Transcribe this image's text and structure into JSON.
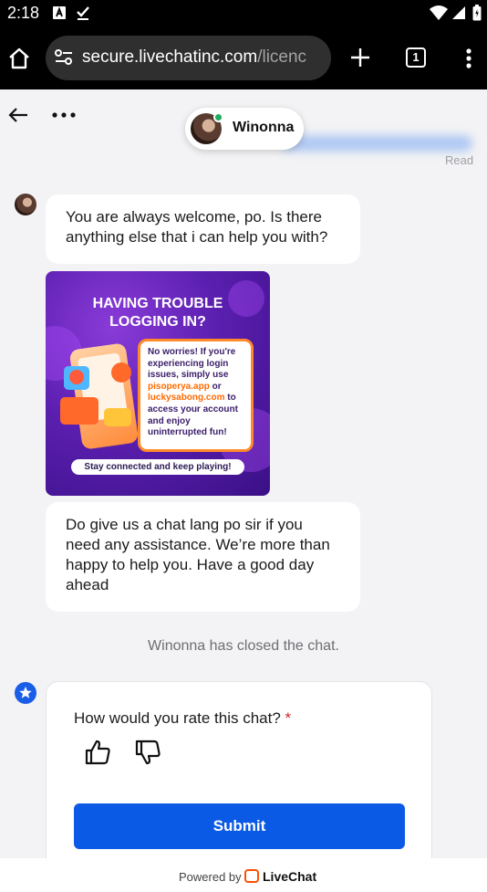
{
  "status_bar": {
    "time": "2:18"
  },
  "browser": {
    "url_host": "secure.livechatinc.com",
    "url_path": "/licenc",
    "tab_count": "1"
  },
  "chat_header": {
    "agent_name": "Winonna",
    "read_label": "Read"
  },
  "messages": [
    {
      "text": "You are always welcome, po. Is there anything else that i can help you with?"
    },
    {
      "text": "Do give us a chat lang po sir if you need any assistance. We’re more than happy to help you. Have a good day ahead"
    }
  ],
  "promo": {
    "title_line1": "HAVING TROUBLE",
    "title_line2": "LOGGING IN?",
    "card_text_1": "No worries! If you're experiencing login issues, simply use",
    "card_link_1": "pisoperya.app",
    "card_or": " or",
    "card_link_2": "luckysabong.com",
    "card_text_2": "to access your account and enjoy uninterrupted fun!",
    "footer": "Stay connected and keep playing!"
  },
  "system_message": "Winonna has closed the chat.",
  "rating": {
    "question": "How would you rate this chat?",
    "required_mark": "*",
    "submit_label": "Submit"
  },
  "footer": {
    "powered_by": "Powered by",
    "brand": "LiveChat"
  },
  "colors": {
    "accent": "#0a5ae6",
    "online": "#1eae5f",
    "livechat_orange": "#ff5100"
  }
}
